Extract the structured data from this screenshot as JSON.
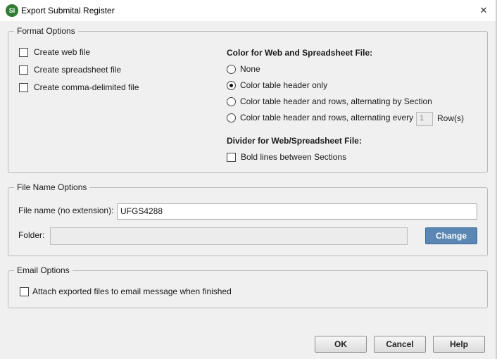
{
  "window": {
    "title": "Export Submital Register",
    "app_icon_text": "SI"
  },
  "format_options": {
    "legend": "Format Options",
    "checkboxes": [
      {
        "label": "Create web file",
        "checked": false
      },
      {
        "label": "Create spreadsheet file",
        "checked": false
      },
      {
        "label": "Create comma-delimited file",
        "checked": false
      }
    ],
    "color_heading": "Color for Web and Spreadsheet File:",
    "color_radios": [
      {
        "label": "None",
        "checked": false
      },
      {
        "label": "Color table header only",
        "checked": true
      },
      {
        "label": "Color table header and rows, alternating by Section",
        "checked": false
      },
      {
        "label": "Color table header and rows, alternating every",
        "checked": false
      }
    ],
    "rows_value": "1",
    "rows_suffix": "Row(s)",
    "divider_heading": "Divider for Web/Spreadsheet File:",
    "divider_checkbox": {
      "label": "Bold lines between Sections",
      "checked": false
    }
  },
  "file_name_options": {
    "legend": "File Name Options",
    "file_name_label": "File name (no extension):",
    "file_name_value": "UFGS4288",
    "folder_label": "Folder:",
    "folder_value": "",
    "change_button": "Change"
  },
  "email_options": {
    "legend": "Email Options",
    "attach_checkbox": {
      "label": "Attach exported files to email message when finished",
      "checked": false
    }
  },
  "buttons": {
    "ok": "OK",
    "cancel": "Cancel",
    "help": "Help"
  },
  "colors": {
    "accent_button": "#5a87b3",
    "app_icon": "#2e7d32"
  }
}
